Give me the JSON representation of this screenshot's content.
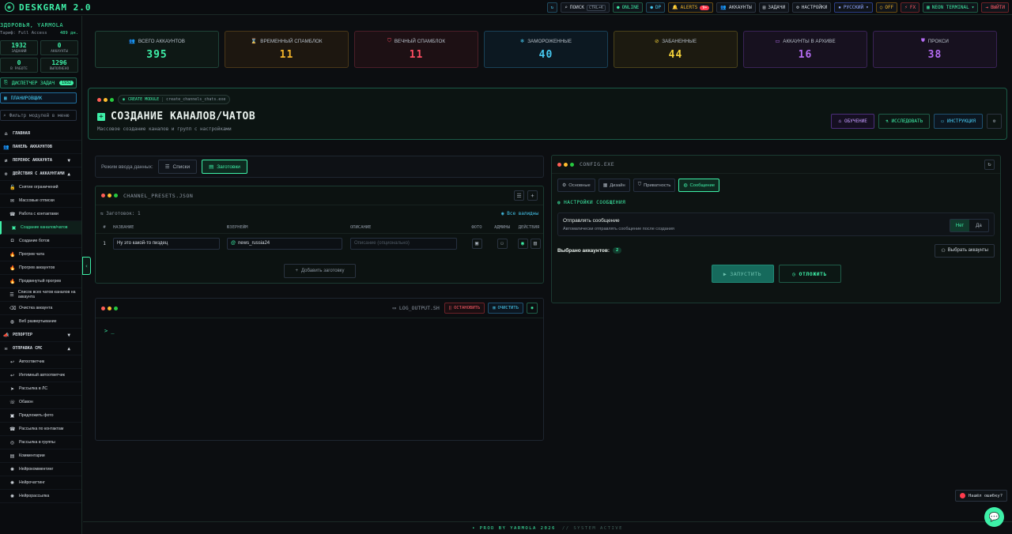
{
  "app": {
    "logo": "DESKGRAM 2.0"
  },
  "topbar": {
    "search_label": "ПОИСК",
    "search_kbd": "CTRL+K",
    "online": "ONLINE",
    "dp": "DP",
    "alerts": "ALERTS",
    "alerts_count": "9+",
    "accounts": "АККАУНТЫ",
    "tasks": "ЗАДАЧИ",
    "settings": "НАСТРОЙКИ",
    "language": "РУССКИЙ",
    "off": "OFF",
    "fx": "FX",
    "theme": "NEON TERMINAL",
    "logout": "ВЫЙТИ"
  },
  "sidebar": {
    "greeting": "ЗДОРОВЬЯ, YARMOLA",
    "tariff_label": "Тариф: Full Access",
    "tariff_days": "489 дн.",
    "stats": [
      {
        "value": "1932",
        "label": "ЗАДАНИЙ"
      },
      {
        "value": "0",
        "label": "АККАУНТЫ"
      },
      {
        "value": "0",
        "label": "В РАБОТЕ"
      },
      {
        "value": "1296",
        "label": "ВЫПОЛНЕНО"
      }
    ],
    "dispatcher": "ДИСПЕТЧЕР ЗАДАЧ",
    "dispatcher_count": "1932",
    "scheduler": "ПЛАНИРОВЩИК",
    "filter_placeholder": "Фильтр модулей в меню",
    "nav": [
      {
        "label": "ГЛАВНАЯ",
        "icon": "home-icon",
        "type": "sec"
      },
      {
        "label": "ПАНЕЛЬ АККАУНТОВ",
        "icon": "users-icon",
        "type": "sec"
      },
      {
        "label": "ПЕРЕНОС АККАУНТА",
        "icon": "transfer-icon",
        "type": "sec",
        "chevron": "▼"
      },
      {
        "label": "ДЕЙСТВИЯ С АККАУНТАМИ",
        "icon": "user-gear-icon",
        "type": "sec",
        "chevron": "▲"
      },
      {
        "label": "Снятие ограничений",
        "icon": "unlock-icon",
        "type": "sub"
      },
      {
        "label": "Массовые отписки",
        "icon": "unsubscribe-icon",
        "type": "sub"
      },
      {
        "label": "Работа с контактами",
        "icon": "contacts-icon",
        "type": "sub"
      },
      {
        "label": "Создание каналов/чатов",
        "icon": "channel-icon",
        "type": "sub",
        "active": true
      },
      {
        "label": "Создание ботов",
        "icon": "bot-icon",
        "type": "sub"
      },
      {
        "label": "Прогрев чата",
        "icon": "fire-icon",
        "type": "sub"
      },
      {
        "label": "Прогрев аккаунтов",
        "icon": "fire-icon",
        "type": "sub"
      },
      {
        "label": "Продвинутый прогрев",
        "icon": "fire-icon",
        "type": "sub"
      },
      {
        "label": "Список всех чатов каналов на аккаунта",
        "icon": "list-icon",
        "type": "sub"
      },
      {
        "label": "Очистка аккаунта",
        "icon": "broom-icon",
        "type": "sub"
      },
      {
        "label": "Веб развертывание",
        "icon": "globe-icon",
        "type": "sub"
      },
      {
        "label": "РЕПОРТЕР",
        "icon": "megaphone-icon",
        "type": "sec",
        "chevron": "▼"
      },
      {
        "label": "ОТПРАВКА СМС",
        "icon": "sms-icon",
        "type": "sec",
        "chevron": "▲"
      },
      {
        "label": "Автоответчик",
        "icon": "autoreply-icon",
        "type": "sub"
      },
      {
        "label": "Интимный автоответчик",
        "icon": "autoreply-icon",
        "type": "sub"
      },
      {
        "label": "Рассылка в ЛС",
        "icon": "send-icon",
        "type": "sub"
      },
      {
        "label": "Обзвон",
        "icon": "phone-icon",
        "type": "sub"
      },
      {
        "label": "Предложить фото",
        "icon": "photo-icon",
        "type": "sub"
      },
      {
        "label": "Рассылка по контактам",
        "icon": "contacts-icon",
        "type": "sub"
      },
      {
        "label": "Рассылка в группы",
        "icon": "group-icon",
        "type": "sub"
      },
      {
        "label": "Комментарии",
        "icon": "comment-icon",
        "type": "sub"
      },
      {
        "label": "Нейрокомментинг",
        "icon": "brain-icon",
        "type": "sub"
      },
      {
        "label": "Нейрочаттинг",
        "icon": "brain-icon",
        "type": "sub"
      },
      {
        "label": "Нейрорассылка",
        "icon": "brain-icon",
        "type": "sub"
      }
    ]
  },
  "cards": [
    {
      "title": "ВСЕГО АККАУНТОВ",
      "value": "395",
      "icon": "users-icon",
      "cls": "k1"
    },
    {
      "title": "ВРЕМЕННЫЙ СПАМБЛОК",
      "value": "11",
      "icon": "hourglass-icon",
      "cls": "k2"
    },
    {
      "title": "ВЕЧНЫЙ СПАМБЛОК",
      "value": "11",
      "icon": "shield-icon",
      "cls": "k3"
    },
    {
      "title": "ЗАМОРОЖЕННЫЕ",
      "value": "40",
      "icon": "snowflake-icon",
      "cls": "k4"
    },
    {
      "title": "ЗАБАНЕННЫЕ",
      "value": "44",
      "icon": "ban-icon",
      "cls": "k5"
    },
    {
      "title": "АККАУНТЫ В АРХИВЕ",
      "value": "16",
      "icon": "archive-icon",
      "cls": "k6"
    },
    {
      "title": "ПРОКСИ",
      "value": "38",
      "icon": "proxy-icon",
      "cls": "k7"
    }
  ],
  "module": {
    "tag": "CREATE MODULE",
    "file": "create_channels_chats.exe",
    "title": "СОЗДАНИЕ КАНАЛОВ/ЧАТОВ",
    "subtitle": "Массовое создание каналов и групп с настройками",
    "btn_learn": "ОБУЧЕНИЕ",
    "btn_research": "ИССЛЕДОВАТЬ",
    "btn_instructions": "ИНСТРУКЦИЯ"
  },
  "mode": {
    "label": "Режим ввода данных:",
    "lists": "Списки",
    "presets": "Заготовки"
  },
  "presets": {
    "title": "CHANNEL_PRESETS.JSON",
    "count_label": "Заготовок: 1",
    "valid_label": "Все валидны",
    "columns": [
      "#",
      "НАЗВАНИЕ",
      "ЮЗЕРНЕЙМ",
      "ОПИСАНИЕ",
      "ФОТО",
      "АДМИНЫ",
      "ДЕЙСТВИЯ"
    ],
    "row": {
      "num": "1",
      "name": "Ну это какой-то пиздец",
      "username": "news_russia24",
      "desc_placeholder": "Описание (опционально)"
    },
    "add_label": "Добавить заготовку"
  },
  "log": {
    "title": "LOG_OUTPUT.SH",
    "stop": "ОСТАНОВИТЬ",
    "clear": "ОЧИСТИТЬ",
    "prompt": "> _"
  },
  "config": {
    "title": "CONFIG.EXE",
    "tabs": [
      "Основные",
      "Дизайн",
      "Приватность",
      "Сообщение"
    ],
    "section": "НАСТРОЙКИ СООБЩЕНИЯ",
    "send_title": "Отправлять сообщение",
    "send_desc": "Автоматически отправлять сообщение после создания",
    "no": "Нет",
    "yes": "Да",
    "selected_label": "Выбрано аккаунтов:",
    "selected_count": "2",
    "select_btn": "Выбрать аккаунты",
    "run": "ЗАПУСТИТЬ",
    "postpone": "ОТЛОЖИТЬ"
  },
  "footer": {
    "text": "• PROD BY YARMOLA 2026",
    "status": "// SYSTEM ACTIVE"
  },
  "bug": {
    "label": "Нашёл ошибку?"
  }
}
